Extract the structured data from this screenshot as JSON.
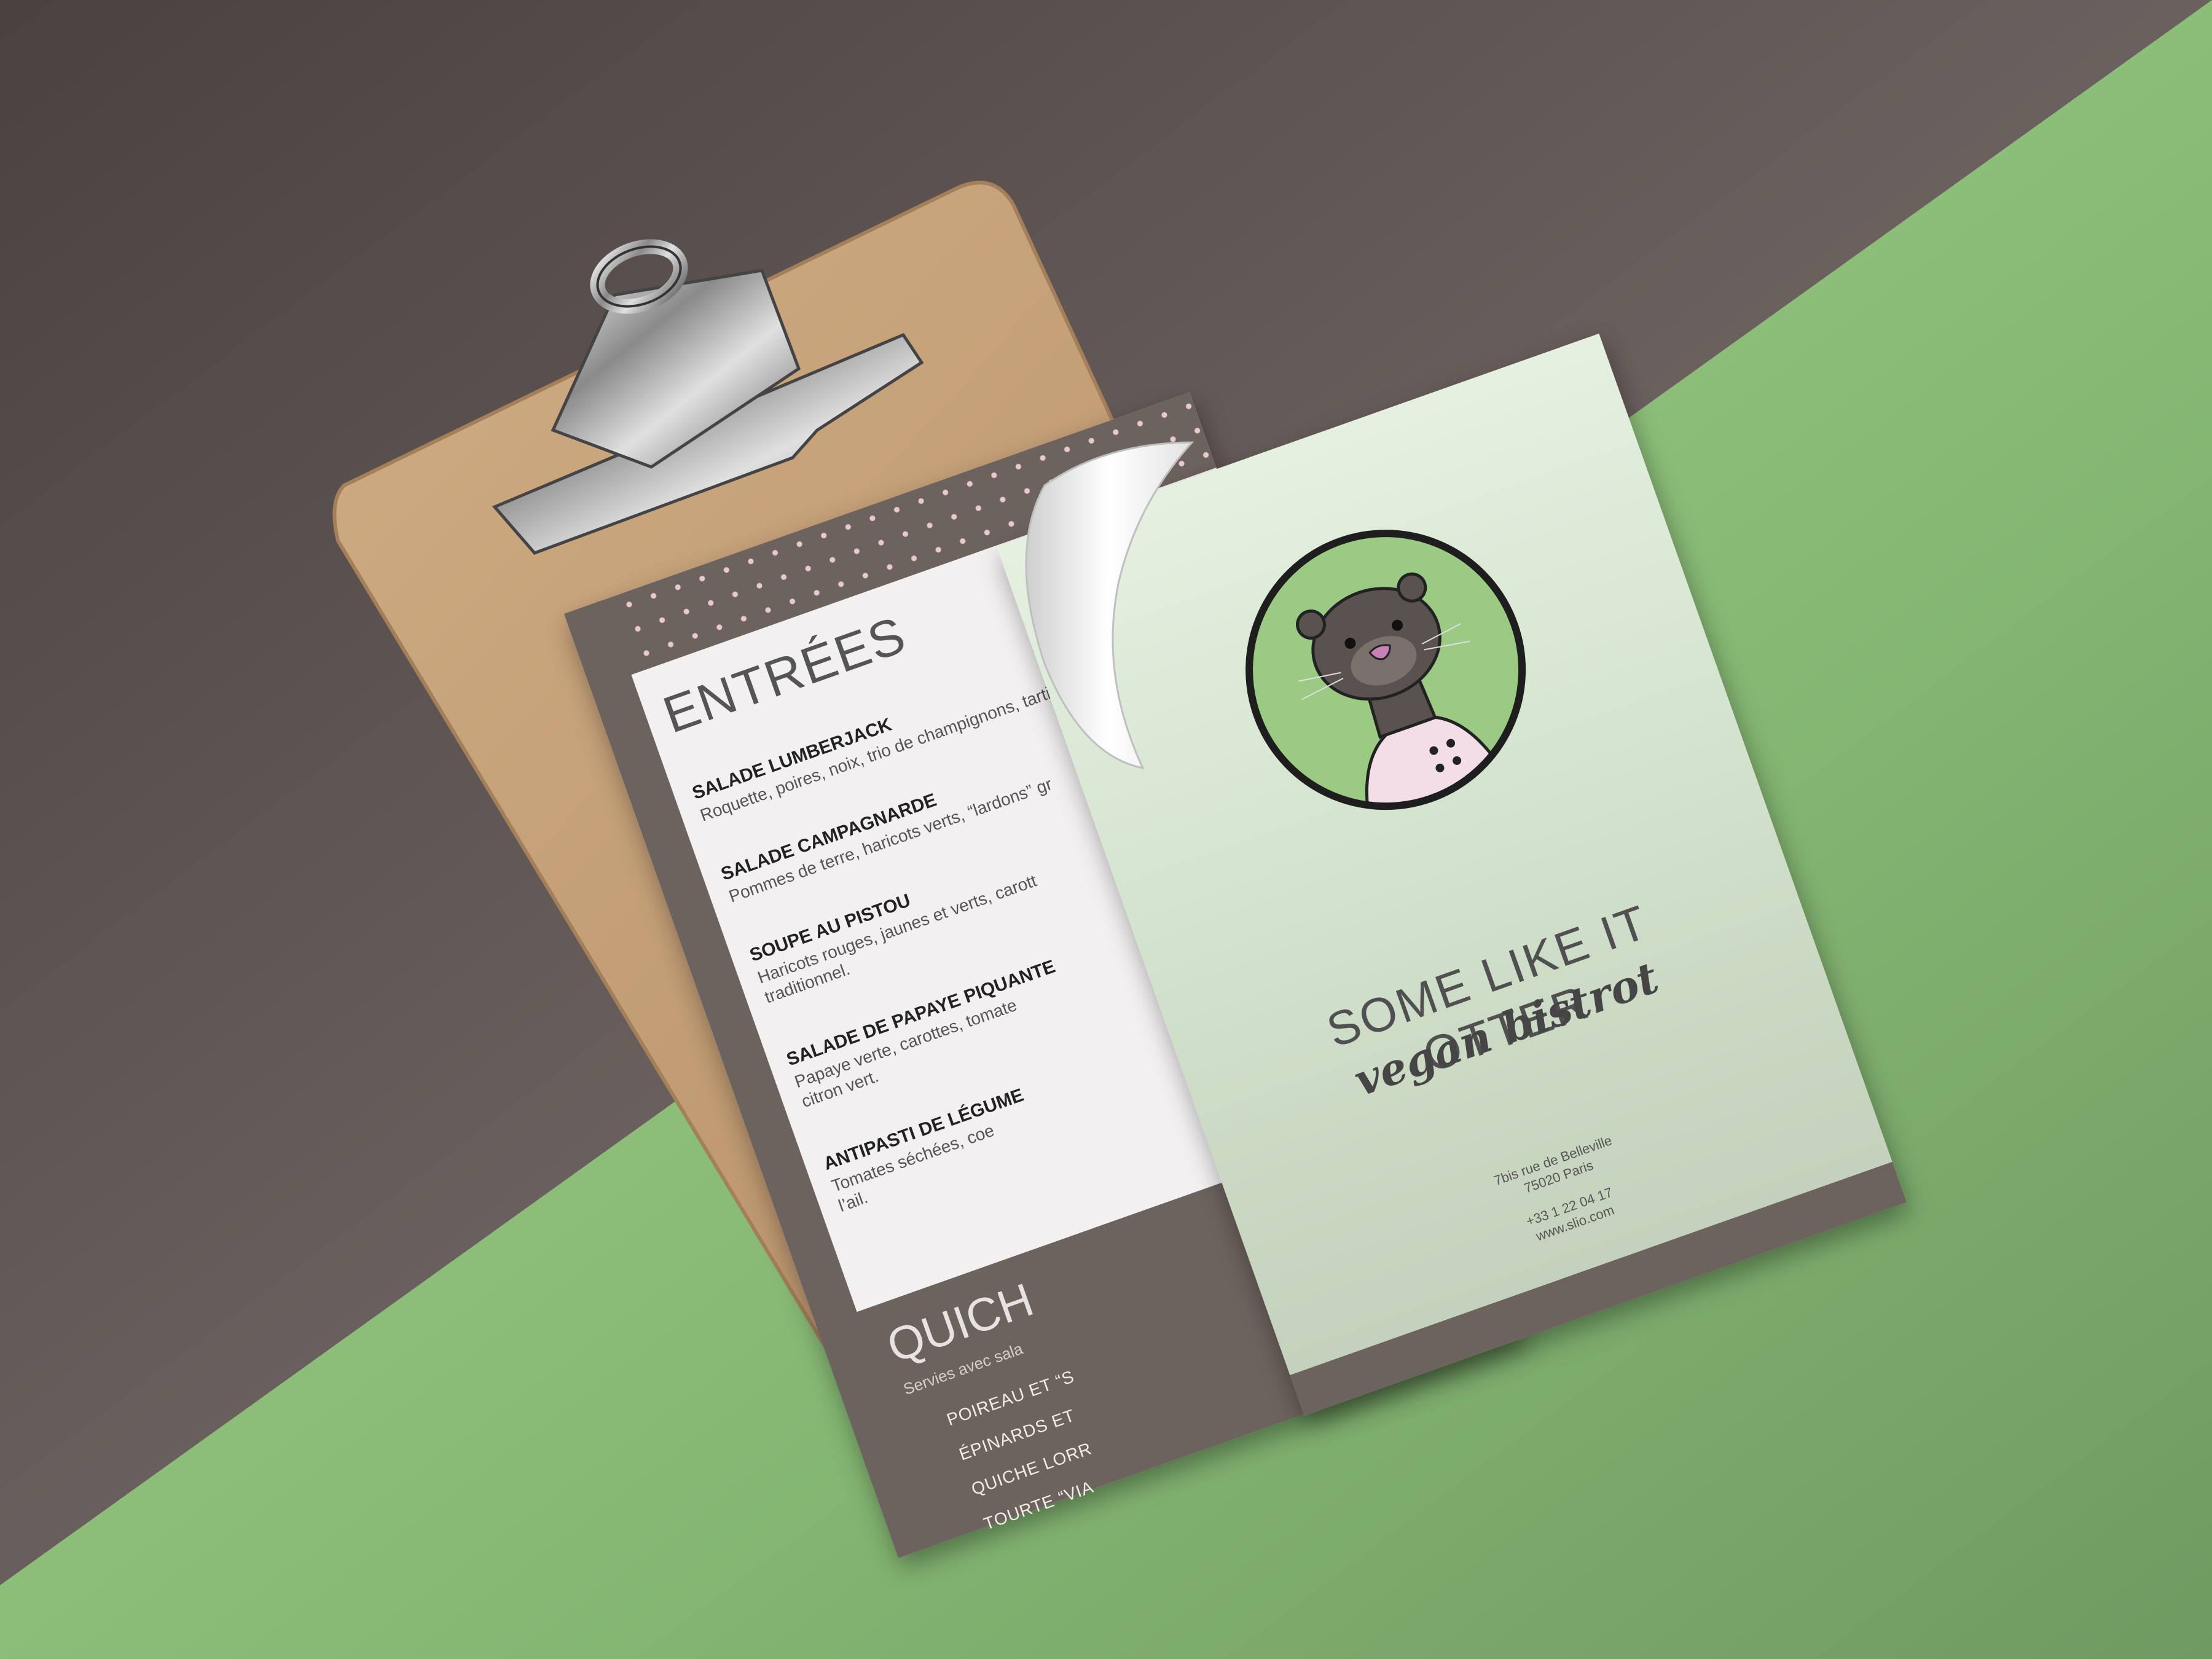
{
  "menu": {
    "section_title": "ENTRÉES",
    "items": [
      {
        "name": "SALADE LUMBERJACK",
        "desc": "Roquette, poires, noix, trio de champignons, tartine"
      },
      {
        "name": "SALADE CAMPAGNARDE",
        "desc": "Pommes de terre, haricots verts, “lardons” gr"
      },
      {
        "name": "SOUPE AU PISTOU",
        "desc": "Haricots rouges, jaunes et verts, carott"
      },
      {
        "name": "SALADE DE PAPAYE PIQUANTE",
        "desc": "Papaye verte, carottes, tomate"
      },
      {
        "name": "ANTIPASTI DE LÉGUME",
        "desc": "Tomates séchées, coe"
      }
    ],
    "desc_extra": [
      "traditionnel.",
      "citron vert.",
      "l’ail."
    ],
    "quiche_title": "QUICH",
    "quiche_sub": "Servies avec sala",
    "quiche_items": [
      "POIREAU ET “S",
      "ÉPINARDS ET",
      "QUICHE LORR",
      "TOURTE “VIA"
    ]
  },
  "cover": {
    "title": "SOME LIKE IT OTTER",
    "subtitle": "vegan bistrot",
    "address_line1": "7bis rue de Belleville",
    "address_line2": "75020 Paris",
    "phone": "+33 1 22 04 17",
    "website": "www.slio.com"
  },
  "colors": {
    "desk": "#5b524f",
    "green_surface": "#8cc07a",
    "clipboard": "#c39f76",
    "menu_band": "#6c625e",
    "cover_green": "#d3e3cd",
    "emblem_green": "#9bcb83",
    "otter_body": "#5a524f",
    "otter_nose": "#c882b8",
    "chef_coat": "#f3dde6"
  },
  "icons": [
    "otter-logo-icon",
    "binder-clip-icon"
  ]
}
